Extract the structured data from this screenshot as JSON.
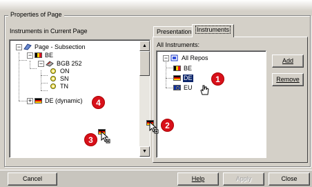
{
  "group": {
    "title": "Properties of Page"
  },
  "left_panel": {
    "label": "Instruments in Current Page",
    "tree": {
      "root": "Page - Subsection",
      "be": "BE",
      "bgb": "BGB 252",
      "on": "ON",
      "sn": "SN",
      "tn": "TN",
      "de_dynamic": "DE (dynamic)"
    }
  },
  "tabs": [
    {
      "label": "Presentation"
    },
    {
      "label": "Instruments"
    }
  ],
  "right_panel": {
    "label": "All Instruments:",
    "tree": {
      "root": "All Repos",
      "be": "BE",
      "de": "DE",
      "eu": "EU"
    },
    "add_label": "Add",
    "remove_label": "Remove"
  },
  "badges": [
    "1",
    "2",
    "3",
    "4"
  ],
  "footer": {
    "cancel": "Cancel",
    "help": "Help",
    "apply": "Apply",
    "close": "Close"
  },
  "colors": {
    "badge": "#d8101a",
    "selection": "#0a246a",
    "dialog_face": "#d4d0c8"
  }
}
